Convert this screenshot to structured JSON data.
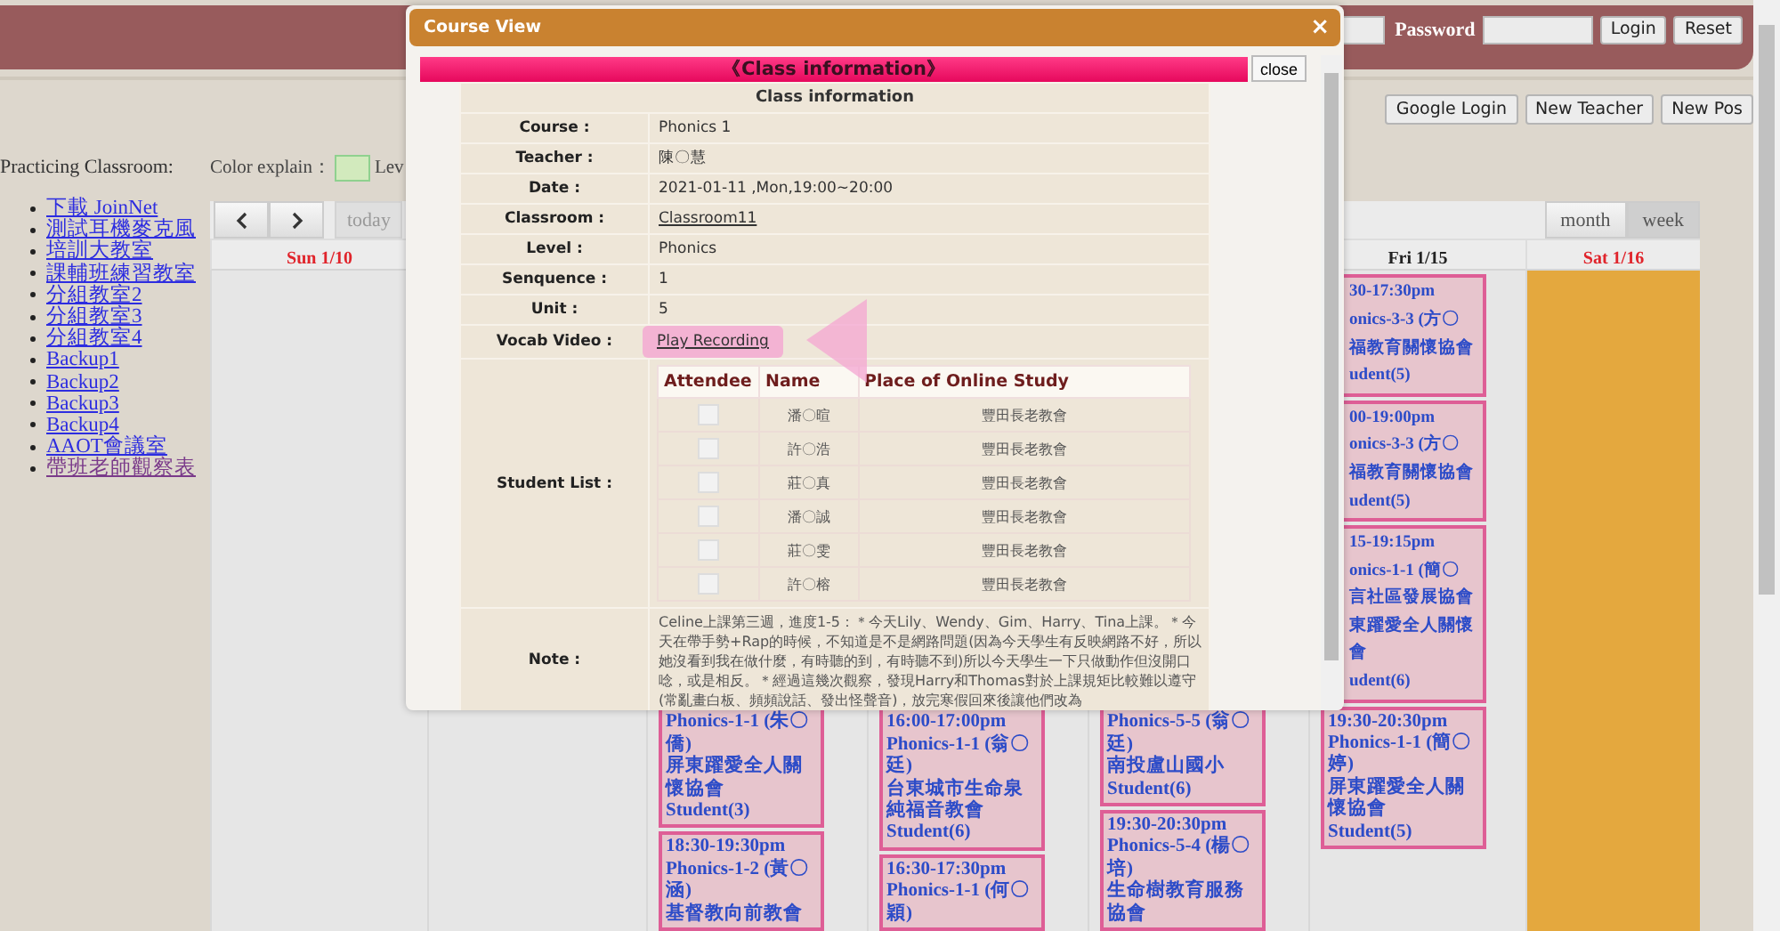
{
  "header": {
    "password_label": "Password",
    "buttons": [
      "Login",
      "Reset"
    ]
  },
  "top_buttons": [
    "Google Login",
    "New Teacher",
    "New Pos"
  ],
  "sidebar": {
    "title": "Practicing Classroom:",
    "links": [
      {
        "label": "下載 JoinNet",
        "visited": false
      },
      {
        "label": "測試耳機麥克風",
        "visited": false
      },
      {
        "label": "培訓大教室",
        "visited": false
      },
      {
        "label": "課輔班練習教室",
        "visited": false
      },
      {
        "label": "分組教室2",
        "visited": false
      },
      {
        "label": "分組教室3",
        "visited": false
      },
      {
        "label": "分組教室4",
        "visited": false
      },
      {
        "label": "Backup1",
        "visited": false
      },
      {
        "label": "Backup2",
        "visited": false
      },
      {
        "label": "Backup3",
        "visited": false
      },
      {
        "label": "Backup4",
        "visited": false
      },
      {
        "label": "AAOT會議室",
        "visited": false
      },
      {
        "label": "帶班老師觀察表",
        "visited": true
      }
    ]
  },
  "color_explain": {
    "label": "Color explain：",
    "legend_text": "Lev"
  },
  "calendar": {
    "today_button": {
      "label": "today",
      "disabled": true
    },
    "views": [
      {
        "label": "month",
        "selected": false
      },
      {
        "label": "week",
        "selected": true
      }
    ],
    "days": [
      {
        "label": "Sun 1/10",
        "weekend": true,
        "highlighted": false
      },
      {
        "highlighted": false
      },
      {
        "highlighted": false,
        "events": [
          {
            "clipped": false,
            "lines": [
              "Phonics-1-1 (朱〇僑)",
              "屏東躍愛全人關懷協會",
              "Student(3)"
            ]
          },
          {
            "clipped": false,
            "lines": [
              "18:30-19:30pm",
              "Phonics-1-2 (黃〇涵)",
              "基督教向前教會"
            ]
          }
        ]
      },
      {
        "highlighted": false,
        "events": [
          {
            "clipped": false,
            "lines": [
              "16:00-17:00pm",
              "Phonics-1-1 (翁〇廷)",
              "台東城市生命泉純福音教會",
              "Student(6)"
            ]
          },
          {
            "clipped": false,
            "lines": [
              "16:30-17:30pm",
              "Phonics-1-1 (何〇穎)"
            ]
          }
        ]
      },
      {
        "highlighted": false,
        "events": [
          {
            "clipped": false,
            "lines": [
              "Phonics-5-5 (翁〇廷)",
              "南投盧山國小",
              "Student(6)"
            ]
          },
          {
            "clipped": false,
            "lines": [
              "19:30-20:30pm",
              "Phonics-5-4 (楊〇培)",
              "生命樹教育服務協會"
            ]
          }
        ]
      },
      {
        "label": "Fri 1/15",
        "weekend": false,
        "highlighted": false,
        "events": [
          {
            "clipped": true,
            "lines": [
              "30-17:30pm",
              "onics-3-3 (方〇",
              "福教育關懷協會",
              "udent(5)"
            ]
          },
          {
            "clipped": true,
            "lines": [
              "00-19:00pm",
              "onics-3-3 (方〇",
              "福教育關懷協會",
              "udent(5)"
            ]
          },
          {
            "clipped": true,
            "lines": [
              "15-19:15pm",
              "onics-1-1 (簡〇",
              "言社區發展協會",
              "東躍愛全人關懷",
              "會",
              "udent(6)"
            ]
          },
          {
            "clipped": false,
            "lines": [
              "19:30-20:30pm",
              "Phonics-1-1 (簡〇婷)",
              "屏東躍愛全人關懷協會",
              "Student(5)"
            ]
          }
        ]
      },
      {
        "label": "Sat 1/16",
        "weekend": true,
        "highlighted": true
      }
    ]
  },
  "modal": {
    "title": "Course View",
    "close_icon": "×",
    "banner": "《Class information》",
    "close_button": "close",
    "section_title": "Class information",
    "fields": [
      {
        "label": "Course :",
        "value": "Phonics 1",
        "kind": "text"
      },
      {
        "label": "Teacher :",
        "value": "陳〇慧",
        "kind": "text"
      },
      {
        "label": "Date :",
        "value": "2021-01-11 ,Mon,19:00~20:00",
        "kind": "text"
      },
      {
        "label": "Classroom :",
        "value": "Classroom11",
        "kind": "link"
      },
      {
        "label": "Level :",
        "value": "Phonics",
        "kind": "text"
      },
      {
        "label": "Senquence :",
        "value": "1",
        "kind": "text"
      },
      {
        "label": "Unit :",
        "value": "5",
        "kind": "text"
      },
      {
        "label": "Vocab Video :",
        "value": "Play Recording",
        "kind": "highlighted-link"
      }
    ],
    "student_list": {
      "label": "Student List :",
      "columns": [
        "Attendee",
        "Name",
        "Place of Online Study"
      ],
      "rows": [
        {
          "attended": false,
          "name": "潘〇暄",
          "place": "豐田長老教會"
        },
        {
          "attended": false,
          "name": "許〇浩",
          "place": "豐田長老教會"
        },
        {
          "attended": false,
          "name": "莊〇真",
          "place": "豐田長老教會"
        },
        {
          "attended": false,
          "name": "潘〇誠",
          "place": "豐田長老教會"
        },
        {
          "attended": false,
          "name": "莊〇雯",
          "place": "豐田長老教會"
        },
        {
          "attended": false,
          "name": "許〇榕",
          "place": "豐田長老教會"
        }
      ]
    },
    "note": {
      "label": "Note :",
      "text": "Celine上課第三週，進度1-5：＊今天Lily、Wendy、Gim、Harry、Tina上課。＊今天在帶手勢+Rap的時候，不知道是不是網路問題(因為今天學生有反映網路不好，所以她沒看到我在做什麼，有時聽的到，有時聽不到)所以今天學生一下只做動作但沒開口唸，或是相反。＊經過這幾次觀察，發現Harry和Thomas對於上課規矩比較難以遵守(常亂畫白板、頻頻說話、發出怪聲音)，放完寒假回來後讓他們改為"
    }
  }
}
